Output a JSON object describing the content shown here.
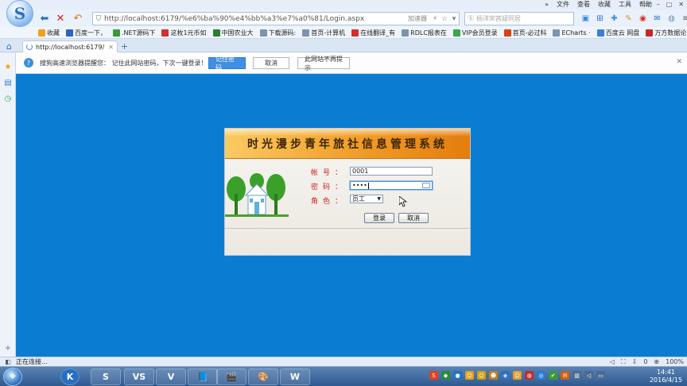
{
  "menubar": {
    "items": [
      "文件",
      "查看",
      "收藏",
      "工具",
      "帮助"
    ],
    "win_controls": [
      "▭",
      "–",
      "▢",
      "✕"
    ]
  },
  "navbar": {
    "logo_glyph": "S",
    "address_url": "http://localhost:6179/%e6%ba%90%e4%bb%a3%e7%a0%81/Login.aspx",
    "accelerator_label": "加速器",
    "search_placeholder": "杨洋宋茜疑同居"
  },
  "bookmarks": [
    {
      "label": "收藏",
      "icon": "star-icon",
      "color": "#f0a020"
    },
    {
      "label": "百度一下，",
      "icon": "baidu-icon",
      "color": "#2a62c9"
    },
    {
      "label": ".NET源码下",
      "icon": "leaf-icon",
      "color": "#3a9a3a"
    },
    {
      "label": "这枚1元币如",
      "icon": "circle-icon",
      "color": "#d03030"
    },
    {
      "label": "中国农业大",
      "icon": "cau-icon",
      "color": "#2e7d32"
    },
    {
      "label": "下载源码:",
      "icon": "page-icon",
      "color": "#7d93b0"
    },
    {
      "label": "首页-计算机",
      "icon": "page-icon",
      "color": "#7d93b0"
    },
    {
      "label": "在线翻译_有",
      "icon": "youdao-icon",
      "color": "#d32f2f"
    },
    {
      "label": "RDLC报表在",
      "icon": "page-icon",
      "color": "#7d93b0"
    },
    {
      "label": "VIP会员登录",
      "icon": "vip-icon",
      "color": "#3aa54a"
    },
    {
      "label": "首页-必过科",
      "icon": "bg-icon",
      "color": "#d84315"
    },
    {
      "label": "ECharts ·",
      "icon": "page-icon",
      "color": "#7d93b0"
    },
    {
      "label": "百度云 网盘",
      "icon": "cloud-icon",
      "color": "#3b7ed6"
    },
    {
      "label": "万方数据论",
      "icon": "wanfang-icon",
      "color": "#c62828"
    }
  ],
  "tab": {
    "label": "http://localhost:6179/",
    "close": "✕",
    "new_tab": "+"
  },
  "notify": {
    "text": "搜狗高速浏览器提醒您：  记住此网站密码，下次一键登录！",
    "remember_btn": "记住密码",
    "cancel_btn": "取消",
    "never_btn": "此网站不再提示",
    "close": "✕"
  },
  "login": {
    "title": "时光漫步青年旅社信息管理系统",
    "account_label": "帐号：",
    "account_value": "0001",
    "password_label": "密码：",
    "password_value": "••••",
    "role_label": "角色：",
    "role_value": "员工",
    "login_btn": "登录",
    "cancel_btn": "取消"
  },
  "statusbar": {
    "text": "正在连接...",
    "zoom": "100%",
    "download_count": "0"
  },
  "taskbar": {
    "time": "14:41",
    "date": "2016/4/15",
    "apps": [
      "K",
      "S",
      "VS",
      "V",
      "📘",
      "🎬",
      "🎨",
      "W"
    ]
  },
  "colors": {
    "accent": "#0a7dd2",
    "banner": "#f09824",
    "label_red": "#cc2222"
  }
}
